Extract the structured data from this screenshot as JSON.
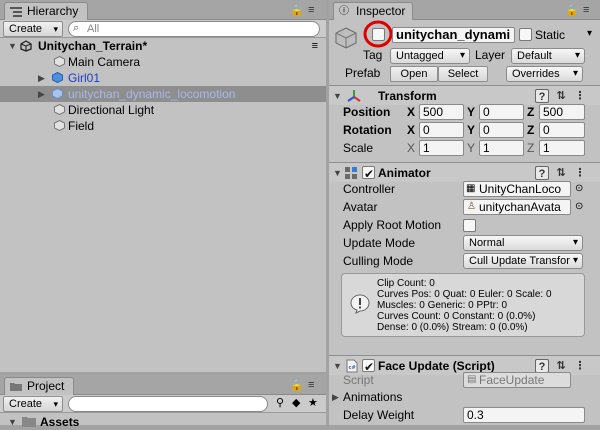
{
  "hierarchy": {
    "tab_label": "Hierarchy",
    "create_label": "Create",
    "search_placeholder": "All",
    "scene_name": "Unitychan_Terrain*",
    "items": [
      {
        "label": "Main Camera",
        "color": "#000000"
      },
      {
        "label": "Girl01",
        "color": "#1a3fc4"
      },
      {
        "label": "unitychan_dynamic_locomotion",
        "color": "#a9b8e8"
      },
      {
        "label": "Directional Light",
        "color": "#000000"
      },
      {
        "label": "Field",
        "color": "#000000"
      }
    ]
  },
  "project": {
    "tab_label": "Project",
    "create_label": "Create",
    "assets_label": "Assets"
  },
  "inspector": {
    "tab_label": "Inspector",
    "object_name": "unitychan_dynami",
    "static_label": "Static",
    "tag_label": "Tag",
    "tag_value": "Untagged",
    "layer_label": "Layer",
    "layer_value": "Default",
    "prefab_label": "Prefab",
    "open_label": "Open",
    "select_label": "Select",
    "overrides_label": "Overrides",
    "transform": {
      "title": "Transform",
      "position_label": "Position",
      "rotation_label": "Rotation",
      "scale_label": "Scale",
      "x": "X",
      "y": "Y",
      "z": "Z",
      "position": [
        "500",
        "0",
        "500"
      ],
      "rotation": [
        "0",
        "0",
        "0"
      ],
      "scale": [
        "1",
        "1",
        "1"
      ]
    },
    "animator": {
      "title": "Animator",
      "controller_label": "Controller",
      "controller_value": "UnityChanLoco",
      "avatar_label": "Avatar",
      "avatar_value": "unitychanAvata",
      "apply_root_motion_label": "Apply Root Motion",
      "update_mode_label": "Update Mode",
      "update_mode_value": "Normal",
      "culling_mode_label": "Culling Mode",
      "culling_mode_value": "Cull Update Transfor",
      "info_lines": [
        "Clip Count: 0",
        "Curves Pos: 0 Quat: 0 Euler: 0 Scale: 0",
        "Muscles: 0 Generic: 0 PPtr: 0",
        "Curves Count: 0 Constant: 0 (0.0%)",
        "Dense: 0 (0.0%) Stream: 0 (0.0%)"
      ]
    },
    "face_update": {
      "title": "Face Update (Script)",
      "script_label": "Script",
      "script_value": "FaceUpdate",
      "animations_label": "Animations",
      "delay_weight_label": "Delay Weight",
      "delay_weight_value": "0.3"
    }
  },
  "colors": {
    "selection": "#8e8e8e",
    "highlight_circle": "#e00000",
    "cube_blue": "#4a8fe0"
  }
}
